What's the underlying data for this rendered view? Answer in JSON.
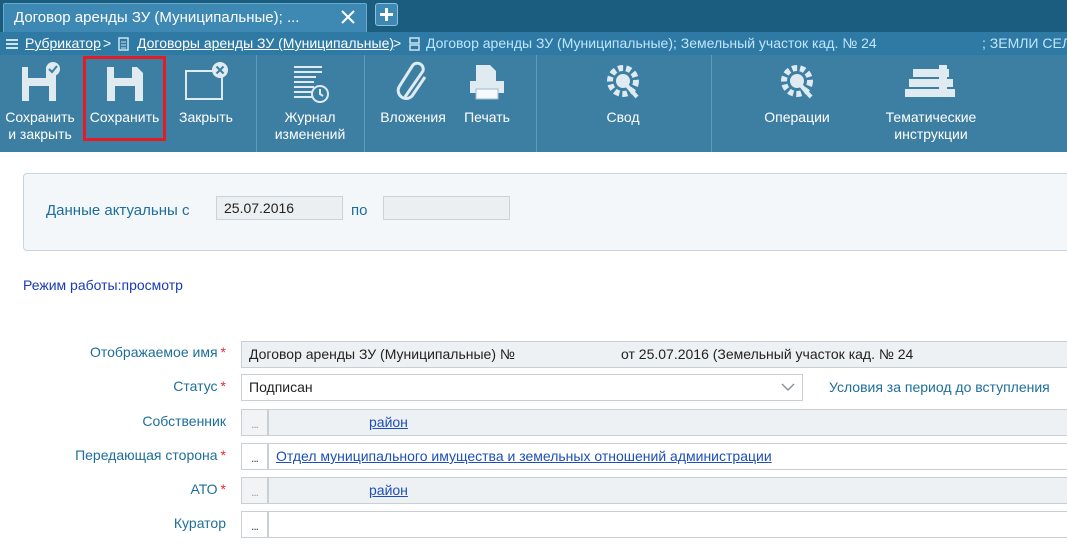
{
  "tab": {
    "title": "Договор аренды ЗУ (Муниципальные); ..."
  },
  "breadcrumb": {
    "item1": "Рубрикатор",
    "sep": ">",
    "item2": "Договоры аренды ЗУ (Муниципальные)",
    "current": "Договор аренды ЗУ (Муниципальные); Земельный участок кад. № 24",
    "extra": "; ЗЕМЛИ СЕЛ"
  },
  "toolbar": {
    "save_close": [
      "Сохранить",
      "и закрыть"
    ],
    "save": "Сохранить",
    "close": "Закрыть",
    "journal": [
      "Журнал",
      "изменений"
    ],
    "attachments": "Вложения",
    "print": "Печать",
    "summary": "Свод",
    "operations": "Операции",
    "thematic": [
      "Тематические",
      "инструкции"
    ]
  },
  "actual": {
    "label_from": "Данные актуальны с",
    "from_value": "25.07.2016",
    "label_to": "по",
    "to_value": ""
  },
  "mode": "Режим работы:просмотр",
  "form": {
    "display_name": {
      "label": "Отображаемое имя",
      "value_left": "Договор аренды ЗУ (Муниципальные) №",
      "value_right": "от 25.07.2016 (Земельный участок  кад. № 24"
    },
    "status": {
      "label": "Статус",
      "value": "Подписан",
      "side_note": "Условия за период до вступления"
    },
    "owner": {
      "label": "Собственник",
      "value": "район"
    },
    "transferring": {
      "label": "Передающая сторона",
      "value": "Отдел муниципального имущества и земельных отношений администрации"
    },
    "ato": {
      "label": "АТО",
      "value": "район"
    },
    "curator": {
      "label": "Куратор",
      "value": ""
    },
    "dots": "..."
  }
}
